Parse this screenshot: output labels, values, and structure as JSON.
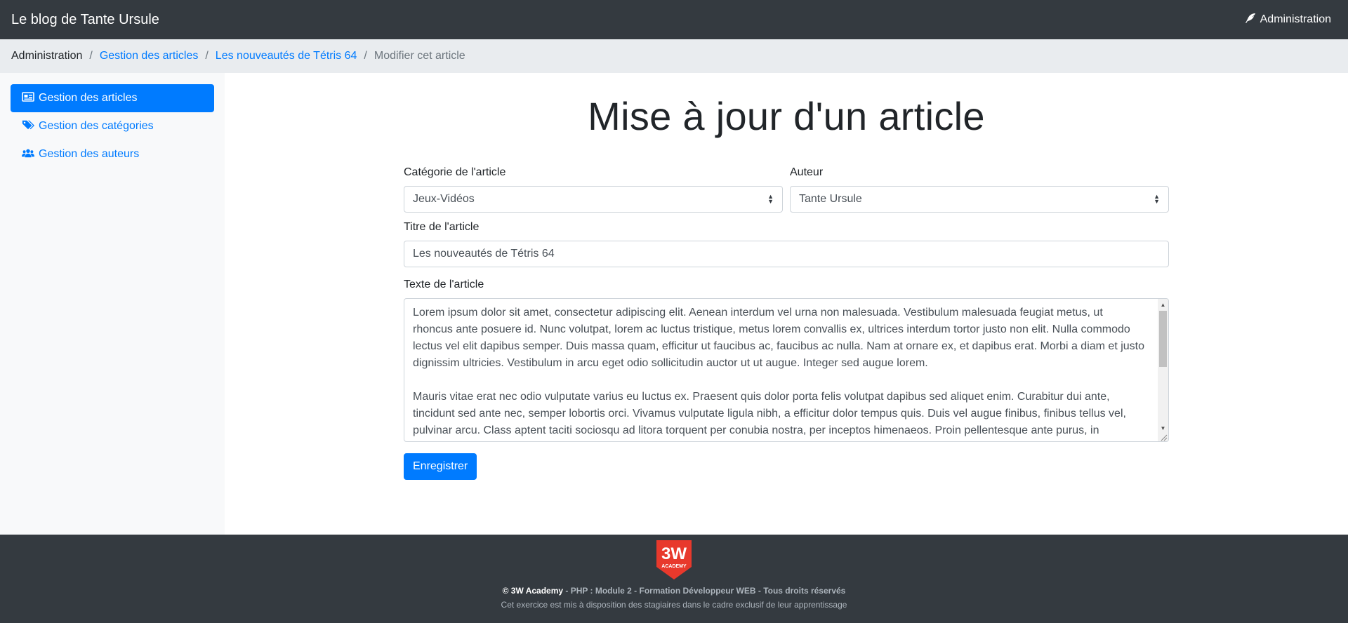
{
  "navbar": {
    "brand": "Le blog de Tante Ursule",
    "admin_label": "Administration"
  },
  "breadcrumb": {
    "items": [
      "Administration",
      "Gestion des articles",
      "Les nouveautés de Tétris 64",
      "Modifier cet article"
    ]
  },
  "sidebar": {
    "items": [
      {
        "label": "Gestion des articles",
        "icon": "newspaper-icon",
        "active": true
      },
      {
        "label": "Gestion des catégories",
        "icon": "tags-icon",
        "active": false
      },
      {
        "label": "Gestion des auteurs",
        "icon": "users-icon",
        "active": false
      }
    ]
  },
  "form": {
    "title": "Mise à jour d'un article",
    "category_label": "Catégorie de l'article",
    "category_value": "Jeux-Vidéos",
    "author_label": "Auteur",
    "author_value": "Tante Ursule",
    "title_label": "Titre de l'article",
    "title_value": "Les nouveautés de Tétris 64",
    "text_label": "Texte de l'article",
    "text_paragraphs": [
      "Lorem ipsum dolor sit amet, consectetur adipiscing elit. Aenean interdum vel urna non malesuada. Vestibulum malesuada feugiat metus, ut rhoncus ante posuere id. Nunc volutpat, lorem ac luctus tristique, metus lorem convallis ex, ultrices interdum tortor justo non elit. Nulla commodo lectus vel elit dapibus semper. Duis massa quam, efficitur ut faucibus ac, faucibus ac nulla. Nam at ornare ex, et dapibus erat. Morbi a diam et justo dignissim ultricies. Vestibulum in arcu eget odio sollicitudin auctor ut ut augue. Integer sed augue lorem.",
      "Mauris vitae erat nec odio vulputate varius eu luctus ex. Praesent quis dolor porta felis volutpat dapibus sed aliquet enim. Curabitur dui ante, tincidunt sed ante nec, semper lobortis orci. Vivamus vulputate ligula nibh, a efficitur dolor tempus quis. Duis vel augue finibus, finibus tellus vel, pulvinar arcu. Class aptent taciti sociosqu ad litora torquent per conubia nostra, per inceptos himenaeos. Proin pellentesque ante purus, in"
    ],
    "submit_label": "Enregistrer"
  },
  "footer": {
    "logo_text": "3W",
    "logo_subtext": "ACADEMY",
    "copyright": "© 3W Academy",
    "course": " - PHP : Module 2 - Formation Développeur WEB - Tous droits réservés",
    "notice": "Cet exercice est mis à disposition des stagiaires dans le cadre exclusif de leur apprentissage"
  },
  "colors": {
    "navbar": "#343a40",
    "primary": "#007bff",
    "breadcrumb_bg": "#e9ecef",
    "sidebar_bg": "#f8f9fa",
    "logo_red": "#e8392c"
  }
}
